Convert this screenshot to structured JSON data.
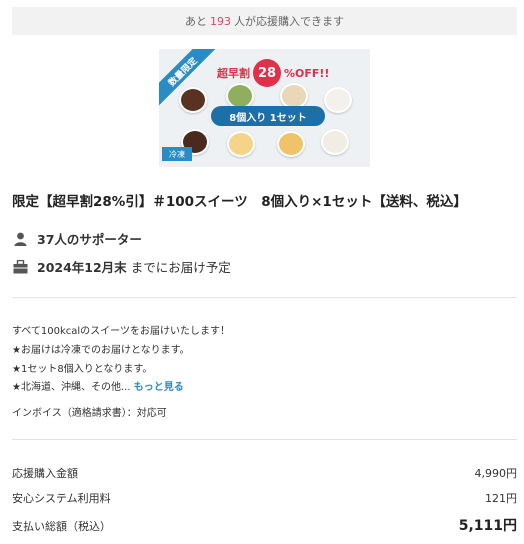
{
  "remaining": {
    "prefix": "あと",
    "count": "193",
    "suffix": "人が応援購入できます"
  },
  "product_image": {
    "ribbon": "数量限定",
    "sale_label": "超早割",
    "sale_percent": "28",
    "sale_suffix": "%OFF!!",
    "pill": "8個入り 1セット",
    "frozen": "冷凍",
    "cup_colors": [
      "#5a3222",
      "#8fae5e",
      "#e9d7b8",
      "#f4f1ec",
      "#4a2a1c",
      "#f5d48a",
      "#f0c36a",
      "#f2ede4"
    ]
  },
  "title": "限定【超早割28%引】＃100スイーツ　8個入り×1セット【送料、税込】",
  "supporters": {
    "icon": "user-icon",
    "count": "37人のサポーター"
  },
  "delivery": {
    "icon": "box-icon",
    "date": "2024年12月末",
    "suffix": "までにお届け予定"
  },
  "description": {
    "lines": [
      "すべて100kcalのスイーツをお届けいたします！",
      "★お届けは冷凍でのお届けとなります。",
      "★1セット8個入りとなります。",
      "★北海道、沖縄、その他..."
    ],
    "more_link": "もっと見る",
    "invoice": "インボイス（適格請求書）：対応可"
  },
  "prices": {
    "support_label": "応援購入金額",
    "support_amount": "4,990円",
    "fee_label": "安心システム利用料",
    "fee_amount": "121円",
    "total_label": "支払い総額（税込）",
    "total_amount": "5,111円"
  }
}
